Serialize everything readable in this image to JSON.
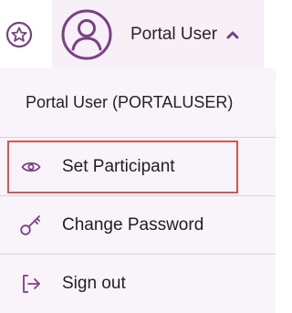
{
  "header": {
    "favorite_icon": "star-icon",
    "user_avatar_icon": "user-avatar-icon",
    "user_name": "Portal User",
    "caret_icon": "chevron-up-icon"
  },
  "menu": {
    "account_label": "Portal User (PORTALUSER)",
    "items": [
      {
        "label": "Set Participant",
        "icon": "eye-icon",
        "highlighted": true
      },
      {
        "label": "Change Password",
        "icon": "key-icon"
      },
      {
        "label": "Sign out",
        "icon": "sign-out-icon"
      }
    ]
  },
  "colors": {
    "accent": "#7a3f86",
    "highlight_border": "#d9534f",
    "menu_background": "#f9f4f9"
  }
}
